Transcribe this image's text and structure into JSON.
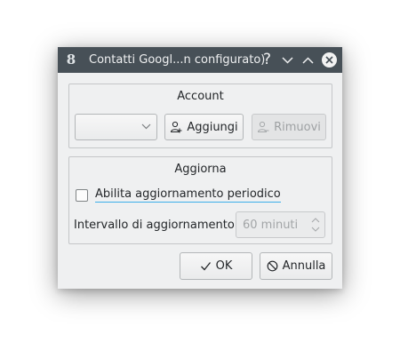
{
  "window": {
    "title": "Contatti Googl...n configurato)",
    "app_icon_glyph": "8",
    "help_glyph": "?"
  },
  "account_group": {
    "title": "Account",
    "combo_value": "",
    "add_label": "Aggiungi",
    "remove_label": "Rimuovi"
  },
  "refresh_group": {
    "title": "Aggiorna",
    "checkbox_label": "Abilita aggiornamento periodico",
    "checkbox_checked": false,
    "interval_label": "Intervallo di aggiornamento:",
    "interval_value": "60 minuti"
  },
  "buttons": {
    "ok_label": "OK",
    "cancel_label": "Annulla"
  },
  "colors": {
    "titlebar": "#475057",
    "dialog_bg": "#eff0f1",
    "focus_underline": "#3daee9"
  },
  "icons": {
    "app": "google-contacts-icon",
    "help": "help-icon",
    "minimize": "minimize-icon",
    "maximize": "maximize-icon",
    "close": "close-icon",
    "add_user": "add-user-icon",
    "remove_user": "remove-user-icon",
    "ok": "checkmark-icon",
    "cancel": "cancel-icon"
  }
}
